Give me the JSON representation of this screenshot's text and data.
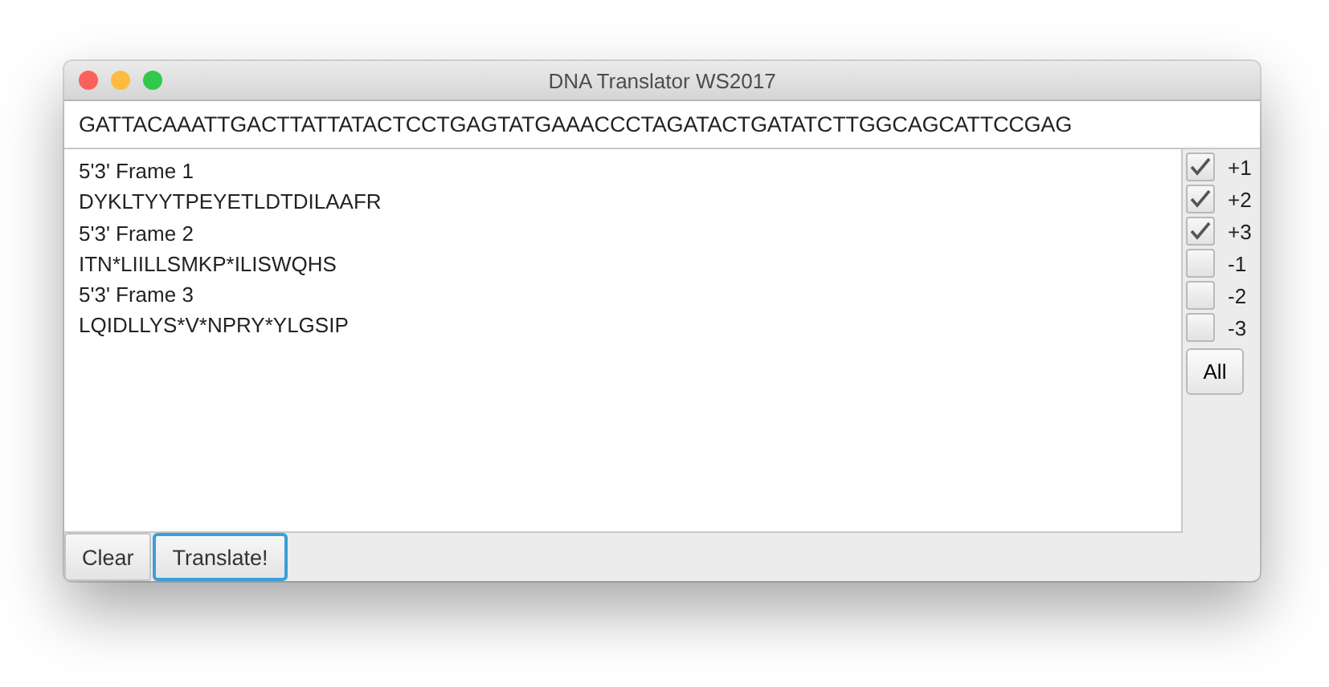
{
  "window": {
    "title": "DNA Translator WS2017"
  },
  "sequence_input": {
    "value": "GATTACAAATTGACTTATTATACTCCTGAGTATGAAACCCTAGATACTGATATCTTGGCAGCATTCCGAG"
  },
  "output_lines": [
    "5'3' Frame 1",
    "DYKLTYYTPEYETLDTDILAAFR",
    "5'3' Frame 2",
    "ITN*LIILLSMKP*ILISWQHS",
    "5'3' Frame 3",
    "LQIDLLYS*V*NPRY*YLGSIP"
  ],
  "frames": [
    {
      "label": "+1",
      "checked": true
    },
    {
      "label": "+2",
      "checked": true
    },
    {
      "label": "+3",
      "checked": true
    },
    {
      "label": "-1",
      "checked": false
    },
    {
      "label": "-2",
      "checked": false
    },
    {
      "label": "-3",
      "checked": false
    }
  ],
  "all_button": "All",
  "buttons": [
    {
      "label": "Clear",
      "focused": false
    },
    {
      "label": "Translate!",
      "focused": true
    }
  ]
}
